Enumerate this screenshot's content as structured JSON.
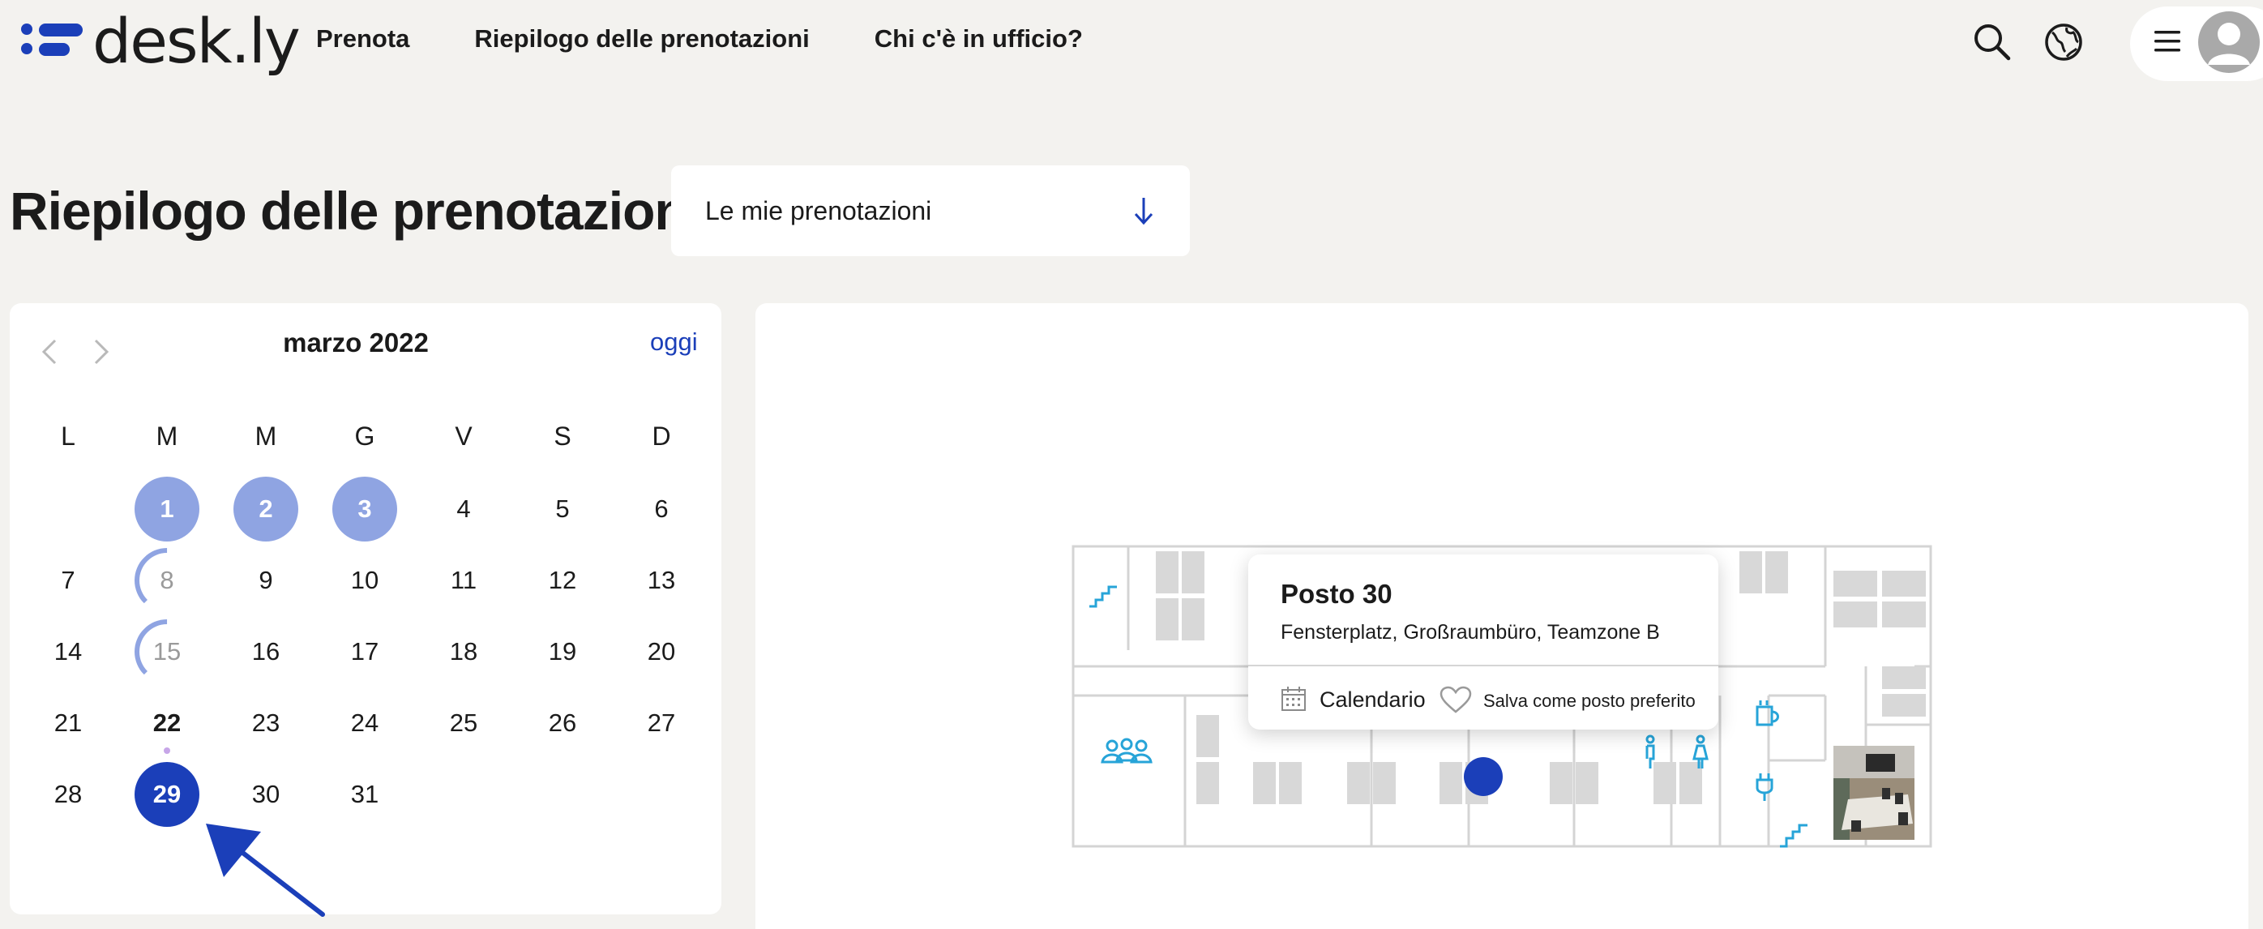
{
  "header": {
    "logo_text": "desk.ly",
    "nav": [
      {
        "label": "Prenota"
      },
      {
        "label": "Riepilogo delle prenotazioni"
      },
      {
        "label": "Chi c'è in ufficio?"
      }
    ],
    "icons": [
      "search-icon",
      "globe-icon",
      "menu-icon",
      "avatar-icon"
    ]
  },
  "page": {
    "title": "Riepilogo delle prenotazioni",
    "filter_value": "Le mie prenotazioni"
  },
  "calendar": {
    "month_label": "marzo 2022",
    "today_label": "oggi",
    "weekdays": [
      "L",
      "M",
      "M",
      "G",
      "V",
      "S",
      "D"
    ],
    "weeks": [
      [
        null,
        "1",
        "2",
        "3",
        "4",
        "5",
        "6"
      ],
      [
        "7",
        "8",
        "9",
        "10",
        "11",
        "12",
        "13"
      ],
      [
        "14",
        "15",
        "16",
        "17",
        "18",
        "19",
        "20"
      ],
      [
        "21",
        "22",
        "23",
        "24",
        "25",
        "26",
        "27"
      ],
      [
        "28",
        "29",
        "30",
        "31",
        null,
        null,
        null
      ]
    ],
    "booked_days": [
      "1",
      "2",
      "3"
    ],
    "half_booked_days": [
      "8",
      "15"
    ],
    "today": "22",
    "selected": "29"
  },
  "popup": {
    "title": "Posto 30",
    "subtitle": "Fensterplatz, Großraumbüro, Teamzone B",
    "calendar_label": "Calendario",
    "favorite_label": "Salva come posto preferito"
  },
  "colors": {
    "accent": "#1b3fb9",
    "booked": "#8fa4e2",
    "background": "#f3f2ef",
    "map_icon": "#27a4d8"
  }
}
